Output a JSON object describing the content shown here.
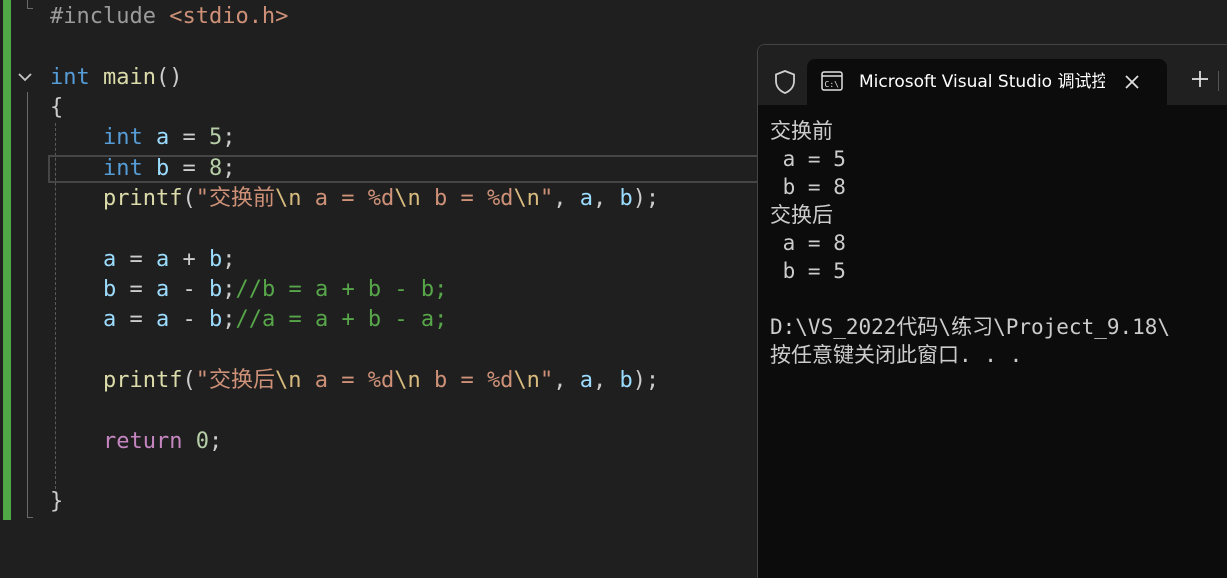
{
  "editor": {
    "lines": [
      {
        "id": "l1",
        "tokens": [
          {
            "t": "#include ",
            "c": "pre"
          },
          {
            "t": "<stdio.h>",
            "c": "str"
          }
        ]
      },
      {
        "id": "l2",
        "tokens": [
          {
            "t": "int",
            "c": "kw"
          },
          {
            "t": " ",
            "c": "punc"
          },
          {
            "t": "main",
            "c": "fn"
          },
          {
            "t": "()",
            "c": "punc"
          }
        ]
      },
      {
        "id": "l3",
        "tokens": [
          {
            "t": "{",
            "c": "punc"
          }
        ]
      },
      {
        "id": "l4",
        "tokens": [
          {
            "t": "    ",
            "c": "punc"
          },
          {
            "t": "int",
            "c": "kw"
          },
          {
            "t": " ",
            "c": "punc"
          },
          {
            "t": "a",
            "c": "var"
          },
          {
            "t": " = ",
            "c": "punc"
          },
          {
            "t": "5",
            "c": "num"
          },
          {
            "t": ";",
            "c": "punc"
          }
        ]
      },
      {
        "id": "l5",
        "tokens": [
          {
            "t": "    ",
            "c": "punc"
          },
          {
            "t": "int",
            "c": "kw"
          },
          {
            "t": " ",
            "c": "punc"
          },
          {
            "t": "b",
            "c": "var"
          },
          {
            "t": " = ",
            "c": "punc"
          },
          {
            "t": "8",
            "c": "num"
          },
          {
            "t": ";",
            "c": "punc"
          }
        ]
      },
      {
        "id": "l6",
        "tokens": [
          {
            "t": "    ",
            "c": "punc"
          },
          {
            "t": "printf",
            "c": "fn"
          },
          {
            "t": "(",
            "c": "punc"
          },
          {
            "t": "\"交换前",
            "c": "str"
          },
          {
            "t": "\\n",
            "c": "esc"
          },
          {
            "t": " a = ",
            "c": "str"
          },
          {
            "t": "%d",
            "c": "str"
          },
          {
            "t": "\\n",
            "c": "esc"
          },
          {
            "t": " b = ",
            "c": "str"
          },
          {
            "t": "%d",
            "c": "str"
          },
          {
            "t": "\\n",
            "c": "esc"
          },
          {
            "t": "\"",
            "c": "str"
          },
          {
            "t": ", ",
            "c": "punc"
          },
          {
            "t": "a",
            "c": "var"
          },
          {
            "t": ", ",
            "c": "punc"
          },
          {
            "t": "b",
            "c": "var"
          },
          {
            "t": ");",
            "c": "punc"
          }
        ]
      },
      {
        "id": "l7",
        "tokens": [
          {
            "t": "    ",
            "c": "punc"
          },
          {
            "t": "a",
            "c": "var"
          },
          {
            "t": " = ",
            "c": "punc"
          },
          {
            "t": "a",
            "c": "var"
          },
          {
            "t": " + ",
            "c": "punc"
          },
          {
            "t": "b",
            "c": "var"
          },
          {
            "t": ";",
            "c": "punc"
          }
        ]
      },
      {
        "id": "l8",
        "tokens": [
          {
            "t": "    ",
            "c": "punc"
          },
          {
            "t": "b",
            "c": "var"
          },
          {
            "t": " = ",
            "c": "punc"
          },
          {
            "t": "a",
            "c": "var"
          },
          {
            "t": " - ",
            "c": "punc"
          },
          {
            "t": "b",
            "c": "var"
          },
          {
            "t": ";",
            "c": "punc"
          },
          {
            "t": "//b = a + b - b;",
            "c": "cmt"
          }
        ]
      },
      {
        "id": "l9",
        "tokens": [
          {
            "t": "    ",
            "c": "punc"
          },
          {
            "t": "a",
            "c": "var"
          },
          {
            "t": " = ",
            "c": "punc"
          },
          {
            "t": "a",
            "c": "var"
          },
          {
            "t": " - ",
            "c": "punc"
          },
          {
            "t": "b",
            "c": "var"
          },
          {
            "t": ";",
            "c": "punc"
          },
          {
            "t": "//a = a + b - a;",
            "c": "cmt"
          }
        ]
      },
      {
        "id": "l10",
        "tokens": [
          {
            "t": "    ",
            "c": "punc"
          },
          {
            "t": "printf",
            "c": "fn"
          },
          {
            "t": "(",
            "c": "punc"
          },
          {
            "t": "\"交换后",
            "c": "str"
          },
          {
            "t": "\\n",
            "c": "esc"
          },
          {
            "t": " a = ",
            "c": "str"
          },
          {
            "t": "%d",
            "c": "str"
          },
          {
            "t": "\\n",
            "c": "esc"
          },
          {
            "t": " b = ",
            "c": "str"
          },
          {
            "t": "%d",
            "c": "str"
          },
          {
            "t": "\\n",
            "c": "esc"
          },
          {
            "t": "\"",
            "c": "str"
          },
          {
            "t": ", ",
            "c": "punc"
          },
          {
            "t": "a",
            "c": "var"
          },
          {
            "t": ", ",
            "c": "punc"
          },
          {
            "t": "b",
            "c": "var"
          },
          {
            "t": ");",
            "c": "punc"
          }
        ]
      },
      {
        "id": "l11",
        "tokens": [
          {
            "t": "    ",
            "c": "punc"
          },
          {
            "t": "return",
            "c": "ctl"
          },
          {
            "t": " ",
            "c": "punc"
          },
          {
            "t": "0",
            "c": "num"
          },
          {
            "t": ";",
            "c": "punc"
          }
        ]
      },
      {
        "id": "l12",
        "tokens": [
          {
            "t": "}",
            "c": "punc"
          }
        ]
      }
    ]
  },
  "terminal": {
    "tab_title": "Microsoft Visual Studio 调试控制台",
    "icons": {
      "shield": "shield-icon",
      "tab": "cmd-icon",
      "close": "close-icon",
      "new_tab": "plus-icon"
    },
    "output": [
      "交换前",
      " a = 5",
      " b = 8",
      "交换后",
      " a = 8",
      " b = 5",
      "",
      "D:\\VS_2022代码\\练习\\Project_9.18\\",
      "按任意键关闭此窗口. . ."
    ]
  },
  "colors": {
    "editor_bg": "#1f1f1f",
    "change_bar": "#4fa845",
    "terminal_bg": "#0c0c0c",
    "tabbar_bg": "#202020"
  }
}
